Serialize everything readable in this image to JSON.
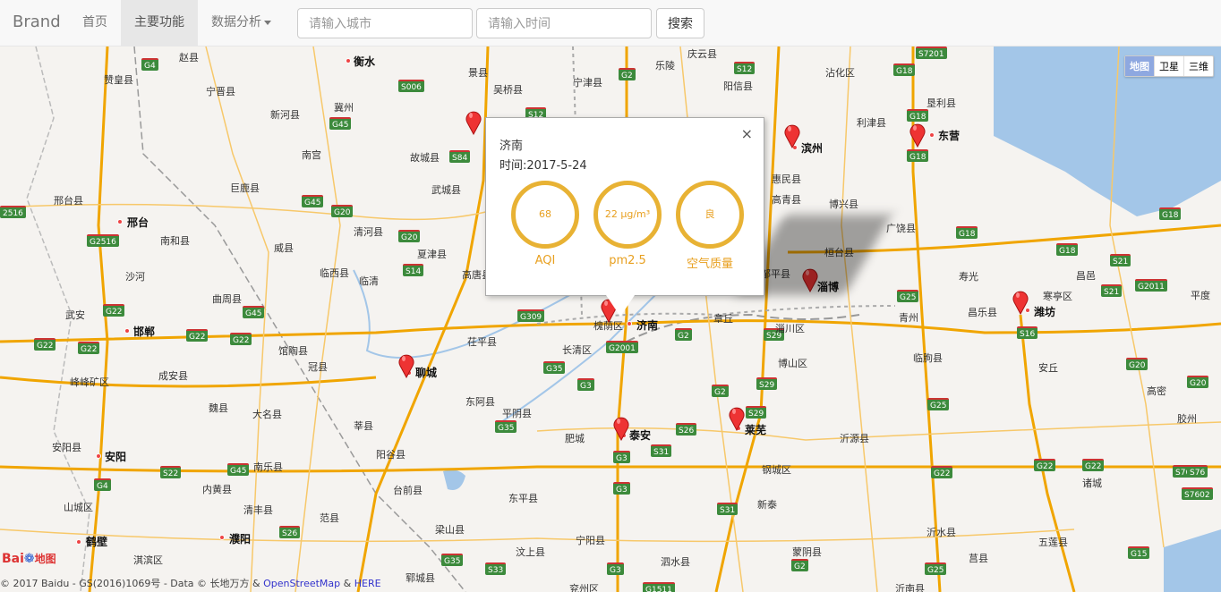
{
  "navbar": {
    "brand": "Brand",
    "items": [
      {
        "label": "首页"
      },
      {
        "label": "主要功能"
      },
      {
        "label": "数据分析"
      }
    ],
    "city_placeholder": "请输入城市",
    "time_placeholder": "请输入时间",
    "search_label": "搜索"
  },
  "map": {
    "type_buttons": [
      "地图",
      "卫星",
      "三维"
    ],
    "cities_major": [
      {
        "name": "济南"
      },
      {
        "name": "泰安"
      },
      {
        "name": "莱芜"
      },
      {
        "name": "聊城"
      },
      {
        "name": "淄博"
      },
      {
        "name": "滨州"
      },
      {
        "name": "东营"
      },
      {
        "name": "潍坊"
      },
      {
        "name": "衡水"
      },
      {
        "name": "邢台"
      },
      {
        "name": "邯郸"
      },
      {
        "name": "安阳"
      },
      {
        "name": "鹤壁"
      },
      {
        "name": "濮阳"
      },
      {
        "name": "德州"
      }
    ],
    "cities_minor": [
      "赵县",
      "景县",
      "吴桥县",
      "宁津县",
      "乐陵",
      "庆云县",
      "沾化区",
      "垦利县",
      "赞皇县",
      "宁晋县",
      "新河县",
      "冀州",
      "阳信县",
      "利津县",
      "故城县",
      "南宫",
      "武城县",
      "惠民县",
      "高青县",
      "博兴县",
      "广饶县",
      "邢台县",
      "巨鹿县",
      "清河县",
      "夏津县",
      "桓台县",
      "寿光",
      "南和县",
      "威县",
      "临西县",
      "临清",
      "高唐县",
      "昌邑",
      "沙河",
      "曲周县",
      "邹平县",
      "昌乐县",
      "寒亭区",
      "平度",
      "武安",
      "馆陶县",
      "茌平县",
      "槐荫区",
      "章丘",
      "青州",
      "峰峰矿区",
      "成安县",
      "冠县",
      "长清区",
      "博山区",
      "淄川区",
      "临朐县",
      "安丘",
      "高密",
      "魏县",
      "东阿县",
      "大名县",
      "莘县",
      "平阴县",
      "肥城",
      "沂源县",
      "安阳县",
      "南乐县",
      "阳谷县",
      "钢城区",
      "诸城",
      "胶州",
      "内黄县",
      "台前县",
      "东平县",
      "新泰",
      "山城区",
      "清丰县",
      "范县",
      "宁阳县",
      "沂水县",
      "五莲县",
      "淇滨区",
      "梁山县",
      "汶上县",
      "蒙阴县",
      "莒县",
      "郓城县",
      "泗水县",
      "兖州区",
      "沂南县",
      "寿光",
      "梁山县"
    ],
    "attribution_text": "© 2017 Baidu - GS(2016)1069号 - Data © 长地万方 & ",
    "attribution_osm": "OpenStreetMap",
    "attribution_amp": " & ",
    "attribution_here": "HERE",
    "logo_text": "Bai",
    "logo_text2": "地图"
  },
  "popup": {
    "city": "济南",
    "time": "时间:2017-5-24",
    "aqi_value": "68",
    "aqi_label": "AQI",
    "pm25_value": "22 μg/m³",
    "pm25_label": "pm2.5",
    "quality_value": "良",
    "quality_label": "空气质量",
    "close": "×"
  },
  "colors": {
    "gauge": "#e8b234",
    "marker": "#e33"
  },
  "icons": [
    "close-icon",
    "map-marker-icon",
    "caret-down-icon"
  ]
}
